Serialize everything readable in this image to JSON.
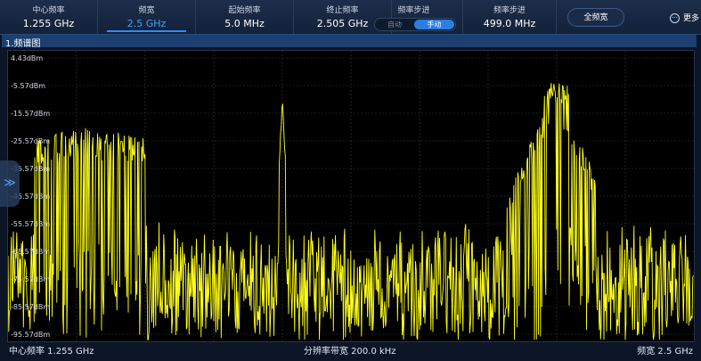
{
  "params": [
    {
      "label": "中心频率",
      "value": "1.255 GHz"
    },
    {
      "label": "频宽",
      "value": "2.5 GHz"
    },
    {
      "label": "起始频率",
      "value": "5.0 MHz"
    },
    {
      "label": "终止频率",
      "value": "2.505 GHz"
    }
  ],
  "freq_step_mode": {
    "label": "频率步进",
    "option_auto": "自动",
    "option_manual": "手动",
    "selected": "手动"
  },
  "freq_step": {
    "label": "频率步进",
    "value": "499.0 MHz"
  },
  "full_span_button": "全频宽",
  "more_button": "更多",
  "panel_title": "1.频谱图",
  "side_handle_icon": "double-chevron-right-icon",
  "more_icon": "ellipsis-circle-icon",
  "y_axis_labels": [
    "4.43dBm",
    "-5.57dBm",
    "-15.57dBm",
    "-25.57dBm",
    "-35.57dBm",
    "-45.57dBm",
    "-55.57dBm",
    "-65.57dBm",
    "-75.57dBm",
    "-85.57dBm",
    "-95.57dBm"
  ],
  "status": {
    "center_freq": "中心频率 1.255 GHz",
    "rbw": "分辨率带宽 200.0 kHz",
    "span": "频宽 2.5 GHz"
  },
  "colors": {
    "trace": "#ffff1a",
    "grid": "#3b3b3b",
    "active_value": "#3ea2ff",
    "accent": "#2a7fe0"
  }
}
